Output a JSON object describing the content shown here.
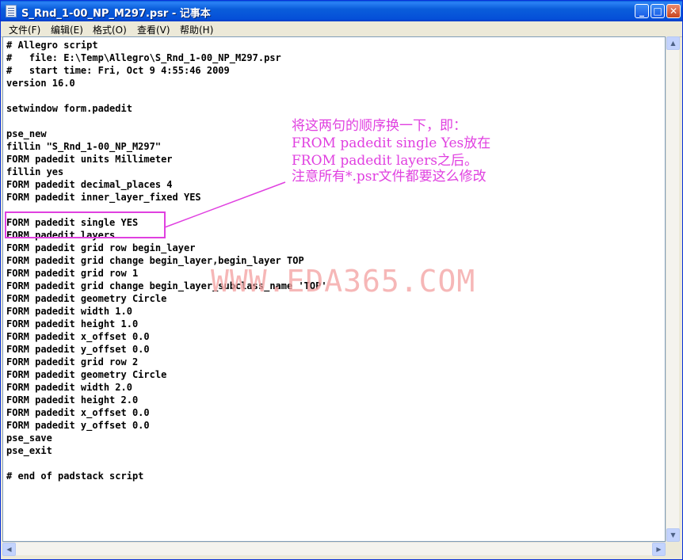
{
  "window": {
    "title": "S_Rnd_1-00_NP_M297.psr - 记事本",
    "buttons": {
      "minimize": "_",
      "maximize": "□",
      "close": "✕"
    }
  },
  "menu": [
    "文件(F)",
    "编辑(E)",
    "格式(O)",
    "查看(V)",
    "帮助(H)"
  ],
  "editor": {
    "lines": [
      "# Allegro script",
      "#   file: E:\\Temp\\Allegro\\S_Rnd_1-00_NP_M297.psr",
      "#   start time: Fri, Oct 9 4:55:46 2009",
      "version 16.0",
      "",
      "setwindow form.padedit",
      "",
      "pse_new",
      "fillin \"S_Rnd_1-00_NP_M297\"",
      "FORM padedit units Millimeter",
      "fillin yes",
      "FORM padedit decimal_places 4",
      "FORM padedit inner_layer_fixed YES",
      "",
      "FORM padedit single YES",
      "FORM padedit layers",
      "FORM padedit grid row begin_layer",
      "FORM padedit grid change begin_layer,begin_layer TOP",
      "FORM padedit grid row 1",
      "FORM padedit grid change begin_layer_subclass_name 'TOP'",
      "FORM padedit geometry Circle",
      "FORM padedit width 1.0",
      "FORM padedit height 1.0",
      "FORM padedit x_offset 0.0",
      "FORM padedit y_offset 0.0",
      "FORM padedit grid row 2",
      "FORM padedit geometry Circle",
      "FORM padedit width 2.0",
      "FORM padedit height 2.0",
      "FORM padedit x_offset 0.0",
      "FORM padedit y_offset 0.0",
      "pse_save",
      "pse_exit",
      "",
      "# end of padstack script"
    ]
  },
  "annotation": {
    "lines": [
      "将这两句的顺序换一下，即：",
      "FROM padedit single Yes放在",
      "FROM padedit layers之后。",
      "注意所有*.psr文件都要这么修改"
    ],
    "color": "#e040e0"
  },
  "watermark": "WWW.EDA365.COM"
}
